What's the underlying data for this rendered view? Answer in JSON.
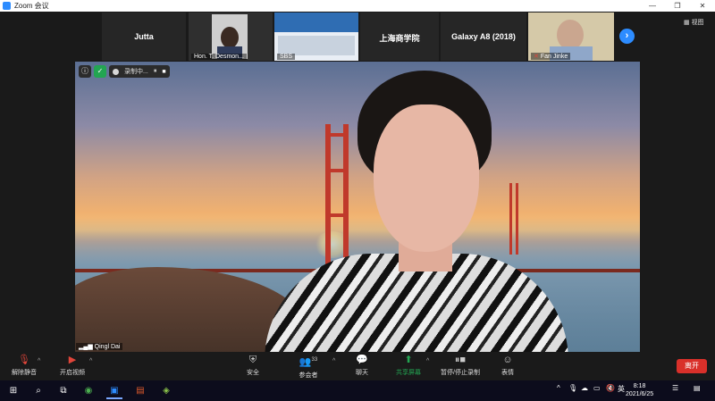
{
  "window": {
    "title": "Zoom 会议",
    "controls": [
      "—",
      "❐",
      "✕"
    ]
  },
  "view_button": "视图",
  "participants": [
    {
      "name": "Jutta",
      "label": "",
      "muted": false,
      "video": false
    },
    {
      "name": "",
      "label": "Hon. T. Desmon...",
      "muted": false,
      "video": true
    },
    {
      "name": "",
      "label": "SBS",
      "muted": false,
      "video": true
    },
    {
      "name": "上海商学院",
      "label": "",
      "muted": false,
      "video": false
    },
    {
      "name": "Galaxy A8 (2018)",
      "label": "",
      "muted": false,
      "video": false
    },
    {
      "name": "",
      "label": "Fan Jinke",
      "muted": true,
      "video": true
    }
  ],
  "next_page_icon": "chevron-right-icon",
  "recording": {
    "status": "录制中...",
    "pause_icon": "⏸",
    "stop_icon": "■"
  },
  "active_speaker": {
    "name": "Qingl Dai"
  },
  "toolbar": {
    "unmute": "解除静音",
    "start_video": "开启视频",
    "security": "安全",
    "participants": "参会者",
    "participant_count": "33",
    "chat": "聊天",
    "share_screen": "共享屏幕",
    "record": "暂停/停止录制",
    "reactions": "表情",
    "leave": "离开"
  },
  "taskbar": {
    "time": "8:18",
    "date": "2021/6/25",
    "ime": "英"
  },
  "colors": {
    "zoom_blue": "#2d8cff",
    "leave_red": "#d9302a",
    "share_green": "#23a552"
  }
}
